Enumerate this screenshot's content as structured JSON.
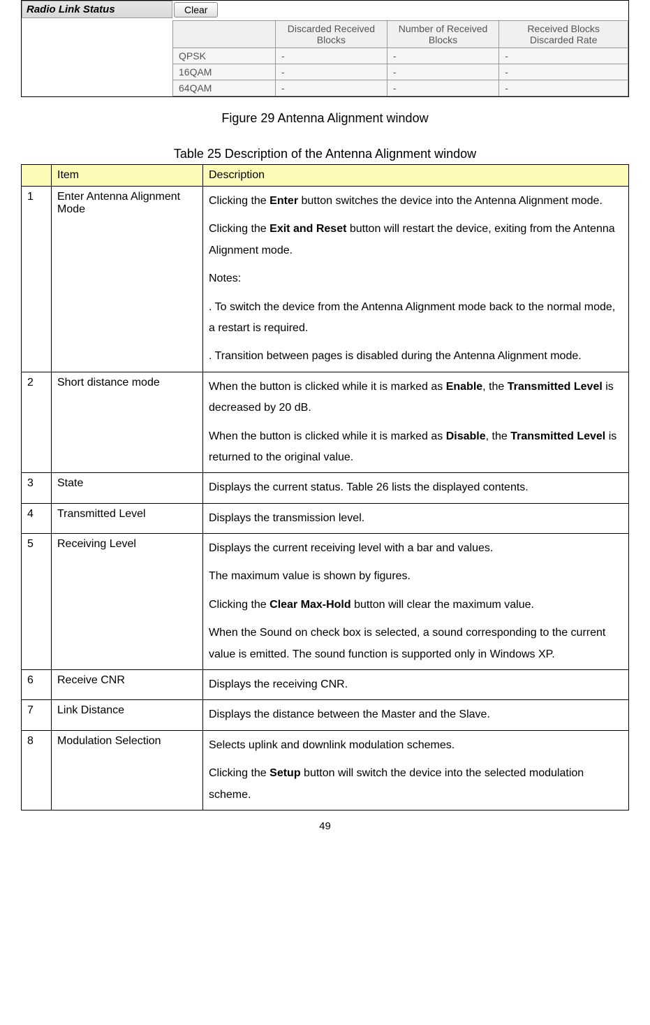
{
  "figure": {
    "panel_title": "Radio Link Status",
    "clear_button": "Clear",
    "columns": [
      "",
      "Discarded Received Blocks",
      "Number of Received Blocks",
      "Received Blocks Discarded Rate"
    ],
    "rows": [
      {
        "label": "QPSK",
        "v1": "-",
        "v2": "-",
        "v3": "-"
      },
      {
        "label": "16QAM",
        "v1": "-",
        "v2": "-",
        "v3": "-"
      },
      {
        "label": "64QAM",
        "v1": "-",
        "v2": "-",
        "v3": "-"
      }
    ]
  },
  "figure_caption": "Figure 29 Antenna Alignment window",
  "table_caption": "Table 25 Description of the Antenna Alignment window",
  "desc_headers": {
    "item": "Item",
    "desc": "Description"
  },
  "desc_rows": [
    {
      "num": "1",
      "item": "Enter Antenna Alignment Mode",
      "desc": [
        {
          "t": "Clicking the <b>Enter</b> button switches the device into the Antenna Alignment mode."
        },
        {
          "t": "Clicking the <b>Exit and Reset</b> button will restart the device, exiting from the Antenna Alignment mode."
        },
        {
          "t": "Notes:"
        },
        {
          "t": ". To switch the device from the Antenna Alignment mode back to the normal mode, a restart is required."
        },
        {
          "t": ". Transition between pages is disabled during the Antenna Alignment mode."
        }
      ]
    },
    {
      "num": "2",
      "item": "Short distance mode",
      "desc": [
        {
          "t": "When the button is clicked while it is marked as <b>Enable</b>, the <b>Transmitted Level</b> is decreased by 20 dB."
        },
        {
          "t": "When the button is clicked while it is marked as <b>Disable</b>, the <b>Transmitted Level</b> is returned to the original value."
        }
      ]
    },
    {
      "num": "3",
      "item": "State",
      "desc": [
        {
          "t": "Displays the current status. Table 26 lists the displayed contents."
        }
      ]
    },
    {
      "num": "4",
      "item": "Transmitted Level",
      "desc": [
        {
          "t": "Displays the transmission level."
        }
      ]
    },
    {
      "num": "5",
      "item": "Receiving Level",
      "desc": [
        {
          "t": "Displays the current receiving level with a bar and values."
        },
        {
          "t": "The maximum value is shown by figures."
        },
        {
          "t": "Clicking the <b>Clear Max-Hold</b> button will clear the maximum value."
        },
        {
          "t": "When the Sound on check box is selected, a sound corresponding to the current value is emitted. The sound function is supported only in Windows XP."
        }
      ]
    },
    {
      "num": "6",
      "item": "Receive CNR",
      "desc": [
        {
          "t": "Displays the receiving CNR."
        }
      ]
    },
    {
      "num": "7",
      "item": "Link Distance",
      "desc": [
        {
          "t": "Displays the distance between the Master and the Slave."
        }
      ]
    },
    {
      "num": "8",
      "item": "Modulation Selection",
      "desc": [
        {
          "t": "Selects uplink and downlink modulation schemes."
        },
        {
          "t": "Clicking the <b>Setup</b> button will switch the device into the selected modulation scheme."
        }
      ]
    }
  ],
  "page_number": "49"
}
